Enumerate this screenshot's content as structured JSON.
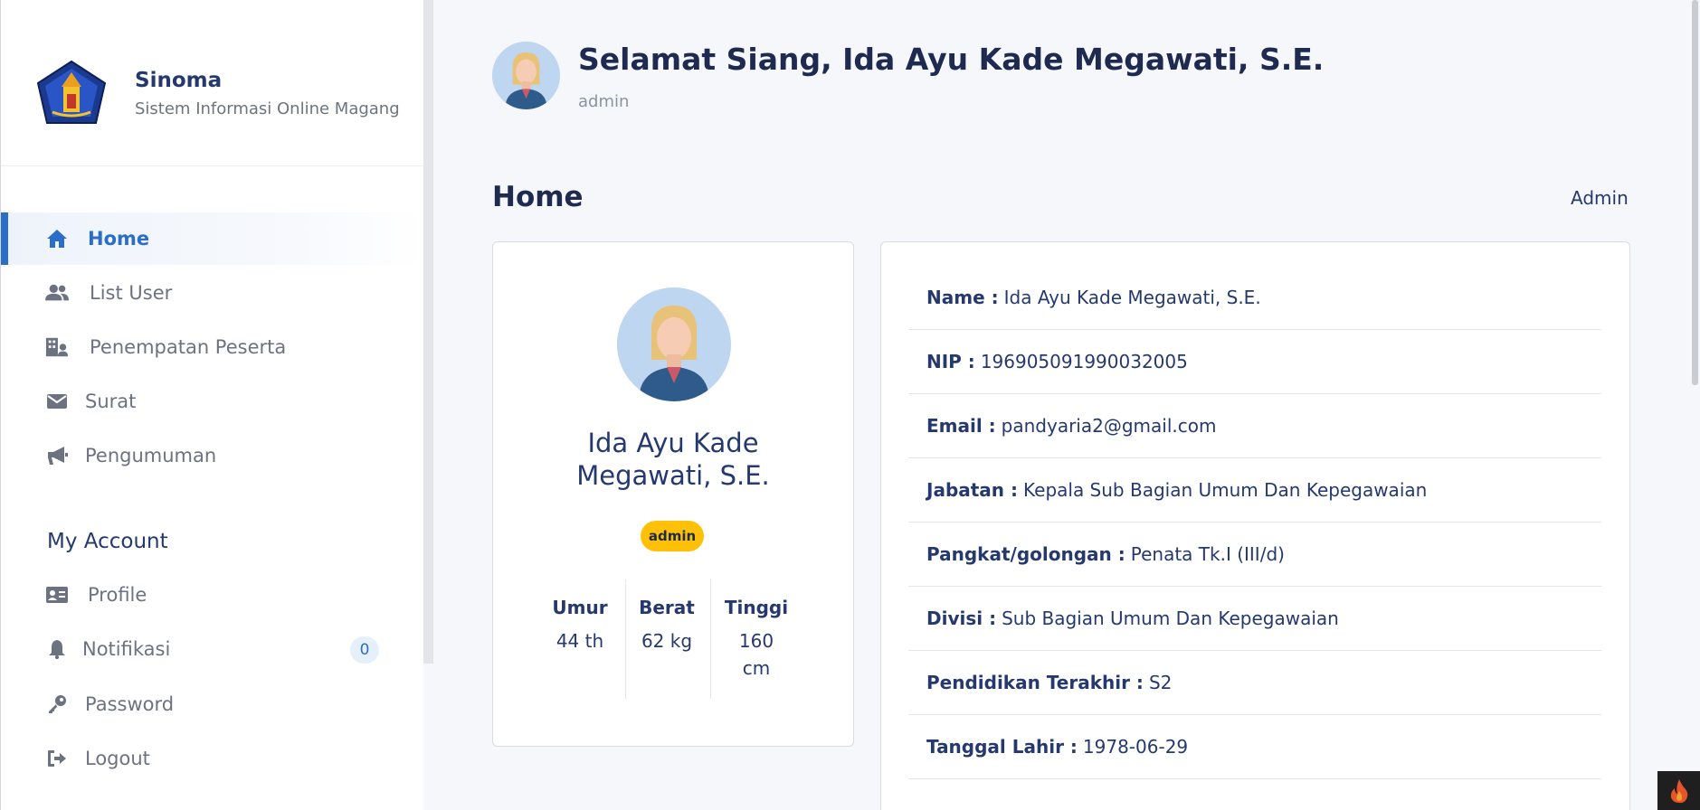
{
  "brand": {
    "name": "Sinoma",
    "subtitle": "Sistem Informasi Online Magang"
  },
  "menu": {
    "items": [
      {
        "label": "Home",
        "icon": "home-icon",
        "active": true
      },
      {
        "label": "List User",
        "icon": "users-icon",
        "active": false
      },
      {
        "label": "Penempatan Peserta",
        "icon": "building-user-icon",
        "active": false
      },
      {
        "label": "Surat",
        "icon": "envelope-icon",
        "active": false
      },
      {
        "label": "Pengumuman",
        "icon": "megaphone-icon",
        "active": false
      }
    ]
  },
  "account": {
    "title": "My Account",
    "items": [
      {
        "label": "Profile",
        "icon": "id-card-icon"
      },
      {
        "label": "Notifikasi",
        "icon": "bell-icon",
        "badge": "0"
      },
      {
        "label": "Password",
        "icon": "key-icon"
      },
      {
        "label": "Logout",
        "icon": "logout-icon"
      }
    ]
  },
  "header": {
    "greeting": "Selamat Siang, Ida Ayu Kade Megawati, S.E.",
    "role": "admin"
  },
  "page": {
    "title": "Home",
    "breadcrumb": "Admin"
  },
  "profile": {
    "name": "Ida Ayu Kade Megawati, S.E.",
    "role_badge": "admin",
    "stats": [
      {
        "label": "Umur",
        "value": "44 th"
      },
      {
        "label": "Berat",
        "value": "62 kg"
      },
      {
        "label": "Tinggi",
        "value": "160 cm"
      }
    ]
  },
  "details": [
    {
      "key": "Name :",
      "value": "Ida Ayu Kade Megawati, S.E."
    },
    {
      "key": "NIP :",
      "value": "196905091990032005"
    },
    {
      "key": "Email :",
      "value": "pandyaria2@gmail.com"
    },
    {
      "key": "Jabatan :",
      "value": "Kepala Sub Bagian Umum Dan Kepegawaian"
    },
    {
      "key": "Pangkat/golongan :",
      "value": "Penata Tk.I (III/d)"
    },
    {
      "key": "Divisi :",
      "value": "Sub Bagian Umum Dan Kepegawaian"
    },
    {
      "key": "Pendidikan Terakhir :",
      "value": "S2"
    },
    {
      "key": "Tanggal Lahir :",
      "value": "1978-06-29"
    }
  ],
  "colors": {
    "accent": "#2b6ec9",
    "badge": "#ffc107",
    "text": "#25396f"
  }
}
